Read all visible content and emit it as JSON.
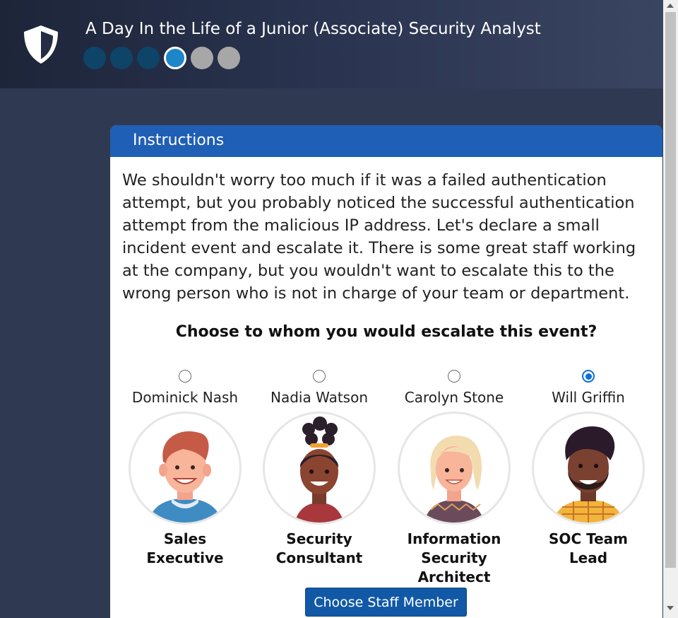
{
  "header": {
    "title": "A Day In the Life of a Junior (Associate) Security Analyst",
    "logo_icon": "shield-icon",
    "progress": {
      "total_steps": 6,
      "current_step": 4,
      "completed_steps": 3
    }
  },
  "panel": {
    "heading": "Instructions",
    "body": "We shouldn't worry too much if it was a failed authentication attempt, but you probably noticed the successful authentication attempt from the malicious IP address. Let's declare a small incident event and escalate it. There is some great staff working at the company, but you wouldn't want to escalate this to the wrong person who is not in charge of your team or department.",
    "question": "Choose to whom you would escalate this event?",
    "staff": [
      {
        "name": "Dominick Nash",
        "role": "Sales Executive",
        "selected": false
      },
      {
        "name": "Nadia Watson",
        "role": "Security Consultant",
        "selected": false
      },
      {
        "name": "Carolyn Stone",
        "role": "Information Security Architect",
        "selected": false
      },
      {
        "name": "Will Griffin",
        "role": "SOC Team Lead",
        "selected": true
      }
    ],
    "submit_label": "Choose Staff Member"
  },
  "colors": {
    "panel_header": "#1f5fb6",
    "button": "#1158a6",
    "progress_done": "#0e4468",
    "progress_current": "#1d86c8",
    "progress_todo": "#a7a7a7",
    "radio_selected": "#0a6fdb"
  }
}
